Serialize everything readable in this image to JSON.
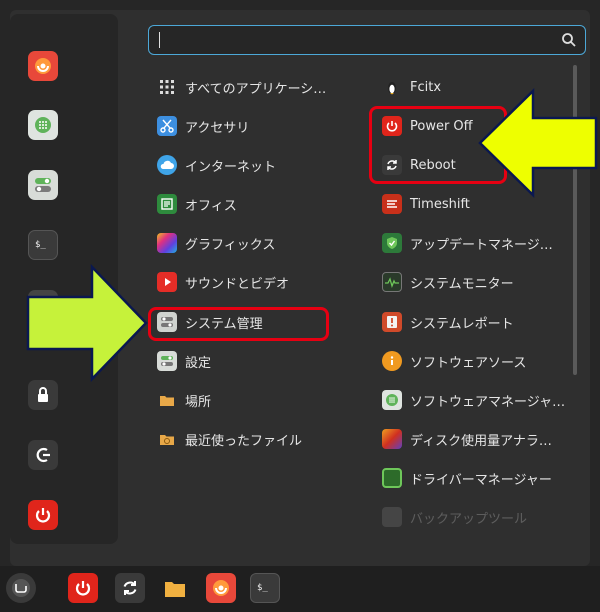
{
  "search": {
    "placeholder": ""
  },
  "apps_left": [
    {
      "label": "すべてのアプリケーシ…",
      "icon": "grid-icon"
    },
    {
      "label": "アクセサリ",
      "icon": "scissors-icon"
    },
    {
      "label": "インターネット",
      "icon": "cloud-icon"
    },
    {
      "label": "オフィス",
      "icon": "office-icon"
    },
    {
      "label": "グラフィックス",
      "icon": "graphics-icon"
    },
    {
      "label": "サウンドとビデオ",
      "icon": "play-icon"
    },
    {
      "label": "システム管理",
      "icon": "toggle-icon"
    },
    {
      "label": "設定",
      "icon": "settings-toggle-icon"
    },
    {
      "label": "場所",
      "icon": "folder-icon"
    },
    {
      "label": "最近使ったファイル",
      "icon": "recent-folder-icon"
    }
  ],
  "apps_right": [
    {
      "label": "Fcitx",
      "icon": "penguin-icon"
    },
    {
      "label": "Power Off",
      "icon": "power-icon"
    },
    {
      "label": "Reboot",
      "icon": "reboot-icon"
    },
    {
      "label": "Timeshift",
      "icon": "timeshift-icon"
    },
    {
      "label": "アップデートマネージ…",
      "icon": "shield-icon"
    },
    {
      "label": "システムモニター",
      "icon": "monitor-icon"
    },
    {
      "label": "システムレポート",
      "icon": "report-icon"
    },
    {
      "label": "ソフトウェアソース",
      "icon": "info-icon"
    },
    {
      "label": "ソフトウェアマネージャ…",
      "icon": "software-icon"
    },
    {
      "label": "ディスク使用量アナラ…",
      "icon": "disk-icon"
    },
    {
      "label": "ドライバーマネージャー",
      "icon": "chip-icon"
    },
    {
      "label": "バックアップツール",
      "icon": "backup-icon"
    }
  ],
  "favorites": [
    "firefox-icon",
    "software-icon",
    "settings-icon",
    "terminal-icon",
    "files-icon",
    "lock-icon",
    "logout-icon",
    "power-icon"
  ],
  "taskbar": [
    "mint-menu-icon",
    "power-icon",
    "reboot-icon",
    "folder-icon",
    "firefox-icon",
    "terminal-icon"
  ],
  "colors": {
    "highlight": "#e60012",
    "arrow": "#eeff00",
    "arrow_green": "#c6f23a",
    "search_border": "#4ca8d8"
  }
}
